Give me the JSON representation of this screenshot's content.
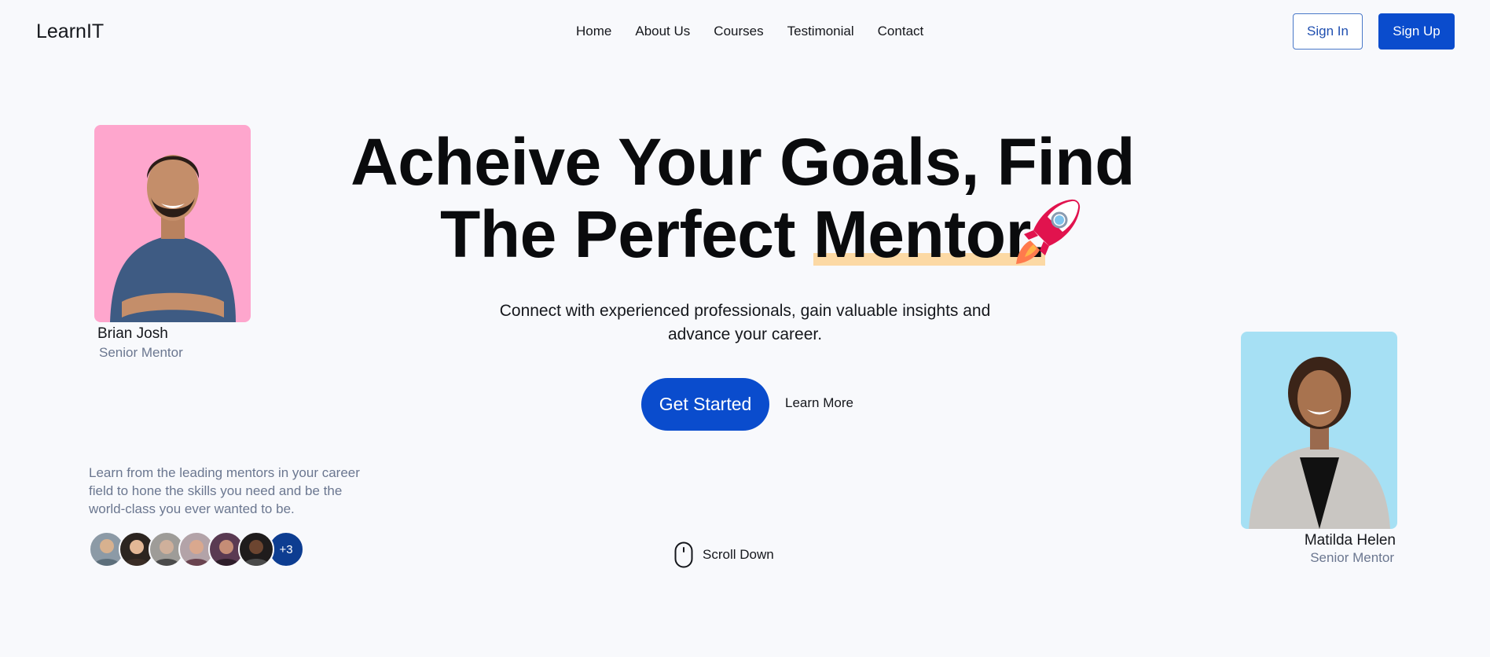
{
  "nav": {
    "logo": "LearnIT",
    "links": [
      "Home",
      "About Us",
      "Courses",
      "Testimonial",
      "Contact"
    ],
    "sign_in": "Sign In",
    "sign_up": "Sign Up"
  },
  "hero": {
    "title_line1": "Acheive Your Goals, Find",
    "title_line2_pre": "The Perfect ",
    "title_highlight": "Mentor.",
    "subtitle": "Connect with experienced professionals, gain valuable insights and advance your career.",
    "cta_primary": "Get Started",
    "cta_secondary": "Learn More"
  },
  "mentors": [
    {
      "name": "Brian Josh",
      "role": "Senior Mentor",
      "bg": "#fea6cd"
    },
    {
      "name": "Matilda Helen",
      "role": "Senior Mentor",
      "bg": "#a6e0f4"
    }
  ],
  "community": {
    "blurb": "Learn from the leading mentors in your career field to hone the skills you need and be the world-class you ever wanted to be.",
    "more_count": "+3"
  },
  "scroll": {
    "label": "Scroll Down"
  },
  "colors": {
    "primary": "#0a4ccd",
    "highlight": "#fcd9a4",
    "muted": "#6b7790"
  }
}
